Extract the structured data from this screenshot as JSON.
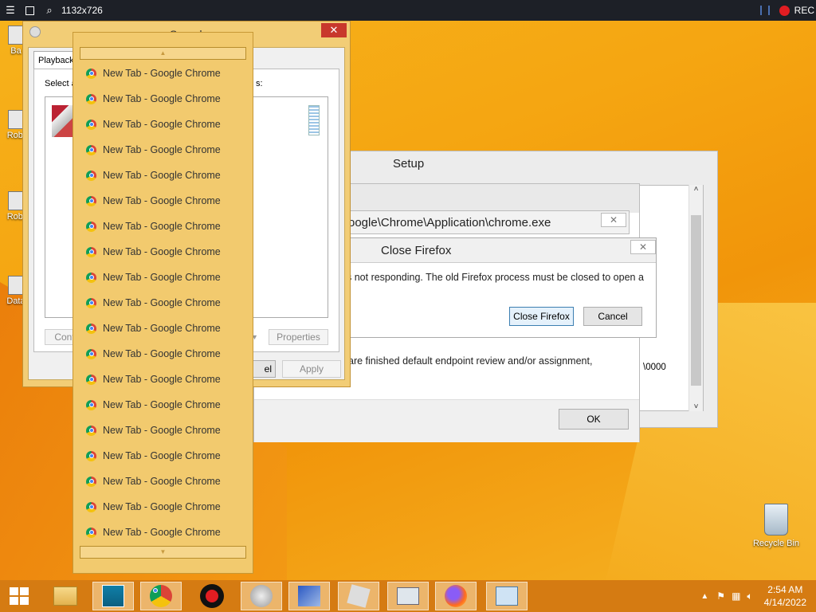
{
  "recorder": {
    "resolution": "1132x726",
    "rec_label": "REC"
  },
  "desktop_icons": [
    {
      "label": "Ba"
    },
    {
      "label": "Robl"
    },
    {
      "label": "Robl"
    },
    {
      "label": "Data"
    }
  ],
  "recycle_bin": {
    "label": "Recycle Bin"
  },
  "sound_window": {
    "title": "Sound",
    "tab": "Playback",
    "select_prefix": "Select a",
    "select_suffix": "s:",
    "configure_label": "Conf",
    "properties_label": "Properties",
    "cancel_partial": "el",
    "apply_label": "Apply"
  },
  "setup_window": {
    "title": "Setup",
    "message": " are finished default endpoint review and/or assignment,",
    "path_tail": "\\0000",
    "ok_label": "OK"
  },
  "path_popup": {
    "text": "oogle\\Chrome\\Application\\chrome.exe"
  },
  "firefox_dialog": {
    "title": "Close Firefox",
    "message": "s not responding. The old Firefox process must be closed to open a",
    "close_button": "Close Firefox",
    "cancel_button": "Cancel"
  },
  "jump_list": {
    "items": [
      "New Tab - Google Chrome",
      "New Tab - Google Chrome",
      "New Tab - Google Chrome",
      "New Tab - Google Chrome",
      "New Tab - Google Chrome",
      "New Tab - Google Chrome",
      "New Tab - Google Chrome",
      "New Tab - Google Chrome",
      "New Tab - Google Chrome",
      "New Tab - Google Chrome",
      "New Tab - Google Chrome",
      "New Tab - Google Chrome",
      "New Tab - Google Chrome",
      "New Tab - Google Chrome",
      "New Tab - Google Chrome",
      "New Tab - Google Chrome",
      "New Tab - Google Chrome",
      "New Tab - Google Chrome",
      "New Tab - Google Chrome"
    ]
  },
  "taskbar": {
    "apps": [
      "start-icon",
      "file-explorer-icon",
      "photos-icon",
      "chrome-icon",
      "record-icon",
      "speaker-icon",
      "network-setup-icon",
      "roblox-icon",
      "monitor-icon",
      "firefox-icon",
      "control-panel-icon"
    ],
    "time": "2:54 AM",
    "date": "4/14/2022"
  },
  "colors": {
    "accent": "#f5a511",
    "window_frame": "#f2cd76",
    "taskbar": "#d57b12",
    "rec_red": "#e11d22"
  }
}
